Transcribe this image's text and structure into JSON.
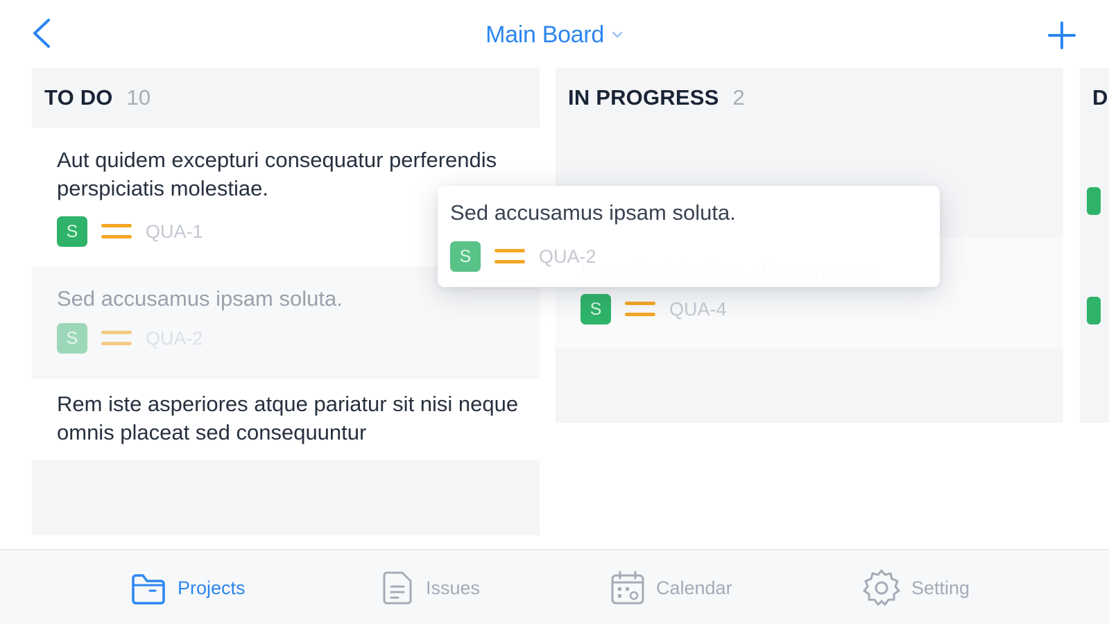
{
  "header": {
    "title": "Main Board",
    "back_icon": "chevron-left-icon",
    "title_dropdown_icon": "chevron-down-icon",
    "add_icon": "plus-icon",
    "accent_color": "#2b86f0"
  },
  "columns": [
    {
      "title": "TO DO",
      "count": "10",
      "cards": [
        {
          "title": "Aut quidem excepturi consequatur perferendis perspiciatis molestiae.",
          "badge": "S",
          "key": "QUA-1"
        },
        {
          "title": "Sed accusamus ipsam soluta.",
          "badge": "S",
          "key": "QUA-2",
          "state": "placeholder"
        },
        {
          "title": "Rem iste asperiores atque pariatur sit nisi neque omnis placeat sed consequuntur",
          "badge": "",
          "key": ""
        }
      ]
    },
    {
      "title": "IN PROGRESS",
      "count": "2",
      "cards": [
        {
          "title": "Impedit doloribus aliquam error.",
          "badge": "S",
          "key": "QUA-4"
        }
      ]
    },
    {
      "title": "D",
      "count": "",
      "cards": []
    }
  ],
  "dragged_card": {
    "title": "Sed accusamus ipsam soluta.",
    "badge": "S",
    "key": "QUA-2"
  },
  "priority_color": "#f5a623",
  "badge_color": "#2fb36a",
  "tabs": [
    {
      "label": "Projects",
      "icon": "folder-icon",
      "active": true
    },
    {
      "label": "Issues",
      "icon": "document-list-icon",
      "active": false
    },
    {
      "label": "Calendar",
      "icon": "calendar-icon",
      "active": false
    },
    {
      "label": "Setting",
      "icon": "gear-icon",
      "active": false
    }
  ]
}
